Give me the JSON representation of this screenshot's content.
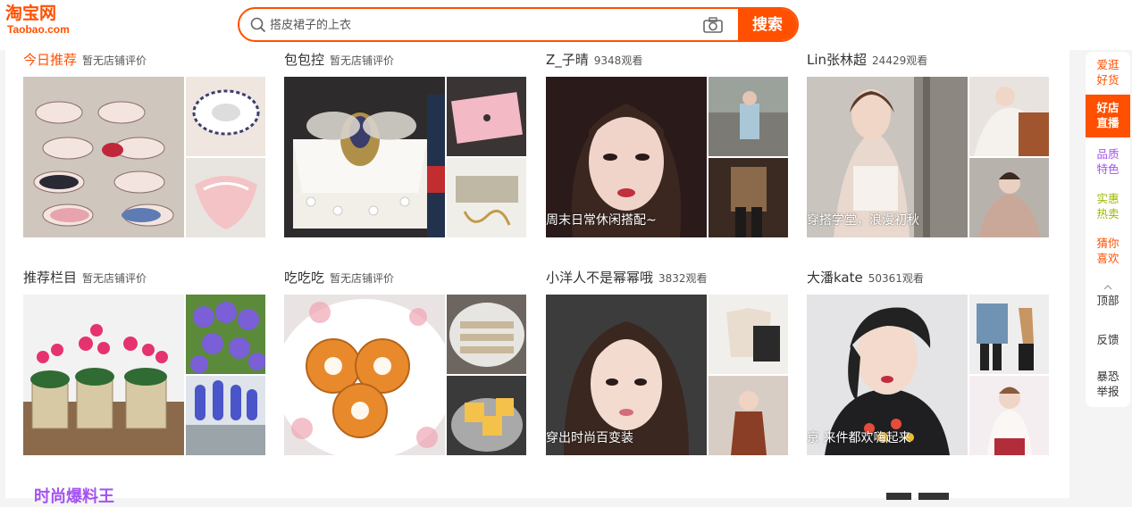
{
  "brand": {
    "logo_cn": "淘宝网",
    "logo_en": "Taobao.com",
    "color": "#ff5000"
  },
  "search": {
    "placeholder": "搭皮裙子的上衣",
    "button_label": "搜索",
    "icon": "search-icon",
    "camera_icon": "camera-icon"
  },
  "cards": [
    {
      "title": "今日推荐",
      "meta": "暂无店铺评价",
      "caption": ""
    },
    {
      "title": "包包控",
      "meta": "暂无店铺评价",
      "caption": ""
    },
    {
      "title": "Z_子晴",
      "meta": "9348观看",
      "caption": "周末日常休闲搭配~"
    },
    {
      "title": "Lin张林超",
      "meta": "24429观看",
      "caption": "穿搭学堂，浪漫初秋"
    },
    {
      "title": "推荐栏目",
      "meta": "暂无店铺评价",
      "caption": ""
    },
    {
      "title": "吃吃吃",
      "meta": "暂无店铺评价",
      "caption": ""
    },
    {
      "title": "小洋人不是幂幂哦",
      "meta": "3832观看",
      "caption": "穿出时尚百变装"
    },
    {
      "title": "大潘kate",
      "meta": "50361观看",
      "caption": "京 来件都欢嗨起来"
    }
  ],
  "bottom": {
    "section_title": "时尚爆料王"
  },
  "sidebar": {
    "items": [
      {
        "line1": "爱逛",
        "line2": "好货",
        "color": "#ff5000"
      },
      {
        "line1": "好店",
        "line2": "直播",
        "color": "#ffffff"
      },
      {
        "line1": "品质",
        "line2": "特色",
        "color": "#a351f0"
      },
      {
        "line1": "实惠",
        "line2": "热卖",
        "color": "#a0b700"
      },
      {
        "line1": "猜你",
        "line2": "喜欢",
        "color": "#ff5000"
      },
      {
        "line1": "顶部",
        "line2": ""
      },
      {
        "line1": "反馈",
        "line2": ""
      },
      {
        "line1": "暴恐",
        "line2": "举报"
      }
    ]
  }
}
